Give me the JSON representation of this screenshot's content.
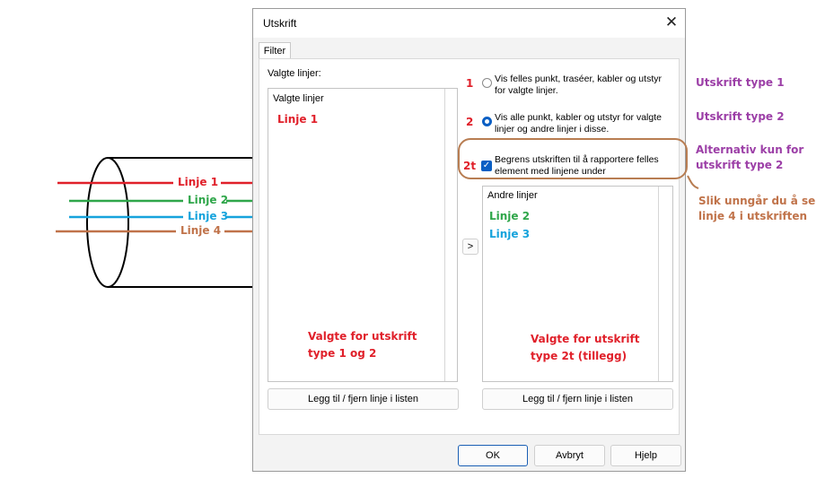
{
  "dialog": {
    "title": "Utskrift",
    "close_glyph": "✕",
    "tab_label": "Filter",
    "selected_lines_label": "Valgte linjer:",
    "left_list": {
      "header": "Valgte linjer",
      "items": [
        "Linje 1"
      ]
    },
    "options": [
      {
        "number": "1",
        "text_line1": "Vis felles punkt, traséer, kabler og utstyr",
        "text_line2": "for valgte linjer.",
        "selected": false
      },
      {
        "number": "2",
        "text_line1": "Vis alle punkt, kabler og utstyr for valgte",
        "text_line2": "linjer og andre linjer i disse.",
        "selected": true
      }
    ],
    "restrict_option": {
      "number": "2t",
      "text_line1": "Begrens utskriften til å rapportere felles",
      "text_line2": "element med linjene under",
      "checked": true
    },
    "move_button_label": ">",
    "right_list": {
      "header": "Andre linjer",
      "items": [
        "Linje 2",
        "Linje 3"
      ]
    },
    "left_caption_line1": "Valgte for utskrift",
    "left_caption_line2": "type 1 og 2",
    "right_caption_line1": "Valgte for utskrift",
    "right_caption_line2": "type 2t (tillegg)",
    "add_remove_left_label": "Legg til / fjern linje i listen",
    "add_remove_right_label": "Legg til / fjern linje i listen",
    "ok_label": "OK",
    "cancel_label": "Avbryt",
    "help_label": "Hjelp"
  },
  "cable": {
    "lines": [
      {
        "label": "Linje 1",
        "color": "#e0202a"
      },
      {
        "label": "Linje 2",
        "color": "#2fa64a"
      },
      {
        "label": "Linje 3",
        "color": "#16a3dc"
      },
      {
        "label": "Linje 4",
        "color": "#c0734a"
      }
    ]
  },
  "annotations": {
    "type1": "Utskrift type 1",
    "type2": "Utskrift type 2",
    "alt_line1": "Alternativ kun for",
    "alt_line2": "utskrift type 2",
    "note_line1": "Slik unngår du å se",
    "note_line2": "linje 4 i utskriften"
  },
  "colors": {
    "accent": "#0a5fc4",
    "red": "#e0202a",
    "green": "#2fa64a",
    "blue": "#16a3dc",
    "orange": "#c0734a",
    "purple": "#9c3fa7"
  }
}
